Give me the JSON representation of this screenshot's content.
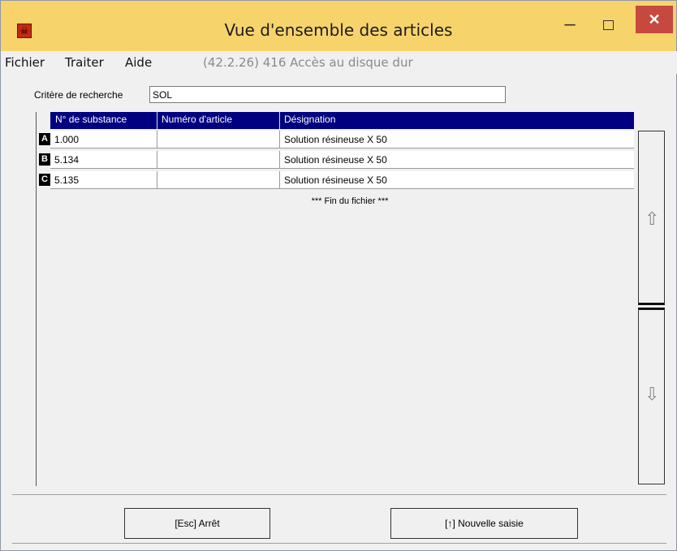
{
  "window": {
    "title": "Vue d'ensemble des articles",
    "icon": "skull-icon",
    "minimize_glyph": "–",
    "close_glyph": "✕",
    "titlebar_color": "#f7d46b",
    "close_color": "#c7483f"
  },
  "menu": {
    "items": [
      "Fichier",
      "Traiter",
      "Aide"
    ],
    "status": "(42.2.26) 416 Accès au disque dur"
  },
  "search": {
    "label": "Critère de recherche",
    "value": "SOL"
  },
  "table": {
    "header_color": "#000080",
    "columns": [
      "N° de substance",
      "Numéro d'article",
      "Désignation"
    ],
    "rows": [
      {
        "tag": "A",
        "substance": "1.000",
        "article": "",
        "designation": "Solution résineuse X 50"
      },
      {
        "tag": "B",
        "substance": "5.134",
        "article": "",
        "designation": "Solution résineuse X 50"
      },
      {
        "tag": "C",
        "substance": "5.135",
        "article": "",
        "designation": "Solution résineuse X 50"
      }
    ],
    "end_text": "*** Fin du fichier ***"
  },
  "scrollbar": {
    "up_icon": "scroll-up-arrow-icon",
    "down_icon": "scroll-down-arrow-icon"
  },
  "buttons": {
    "stop": "[Esc] Arrêt",
    "new_entry": "[↑] Nouvelle saisie"
  }
}
